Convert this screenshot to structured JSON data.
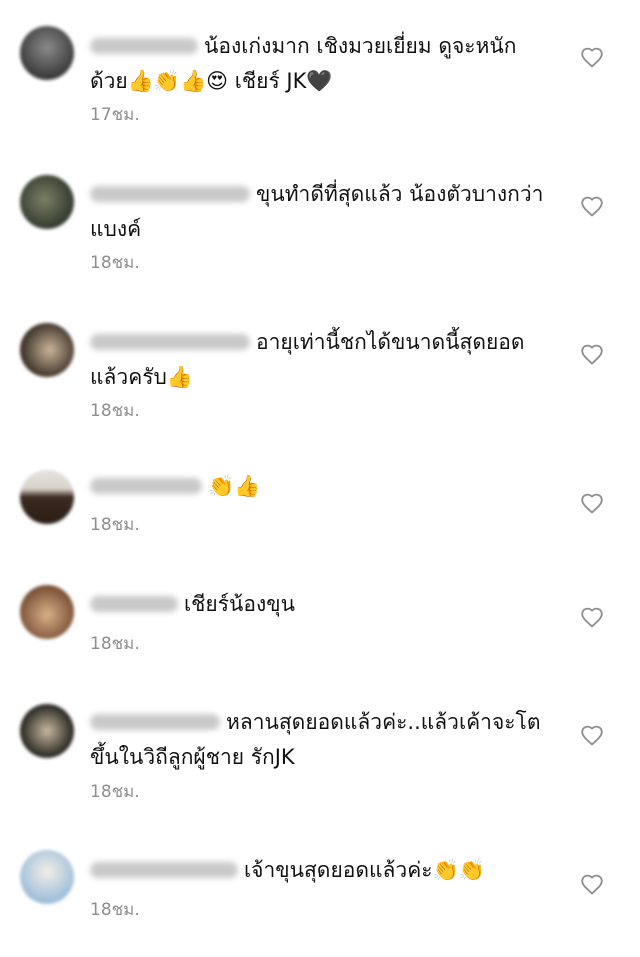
{
  "comments": [
    {
      "username": "kritsnur95",
      "text": "น้องเก่งมาก เชิงมวยเยี่ยม ดูจะหนักด้วย👍👏👍😍 เชียร์ JK🖤",
      "time": "17ชม.",
      "avatar_color": "#5e5e5e",
      "like_icon": "heart-outline-icon"
    },
    {
      "username": "jaccy_sirakarn",
      "text": "ขุนทำดีที่สุดแล้ว น้องตัวบางกว่าแบงค์",
      "time": "18ชม.",
      "avatar_color": "#4a5140",
      "like_icon": "heart-outline-icon"
    },
    {
      "username": "ohs_pakpoom",
      "text": "อายุเท่านี้ชกได้ขนาดนี้สุดยอดแล้วครับ👍",
      "time": "18ชม.",
      "avatar_color": "#6b5a48",
      "like_icon": "heart-outline-icon"
    },
    {
      "username": "heinsaane",
      "text": "👏👍",
      "time": "18ชม.",
      "avatar_color": "#5a4536",
      "like_icon": "heart-outline-icon"
    },
    {
      "username": "eer_nee",
      "text": "เชียร์น้องขุน",
      "time": "18ชม.",
      "avatar_color": "#b48a66",
      "like_icon": "heart-outline-icon"
    },
    {
      "username": "sa_sopmantco",
      "text": "หลานสุดยอดแล้วค่ะ..แล้วเค้าจะโตขึ้นในวิถีลูกผู้ชาย รักJK",
      "time": "18ชม.",
      "avatar_color": "#3d3a33",
      "like_icon": "heart-outline-icon"
    },
    {
      "username": "lattapha_mum",
      "text": "เจ้าขุนสุดยอดแล้วค่ะ👏👏",
      "time": "18ชม.",
      "avatar_color": "#a9c7e0",
      "like_icon": "heart-outline-icon"
    }
  ]
}
